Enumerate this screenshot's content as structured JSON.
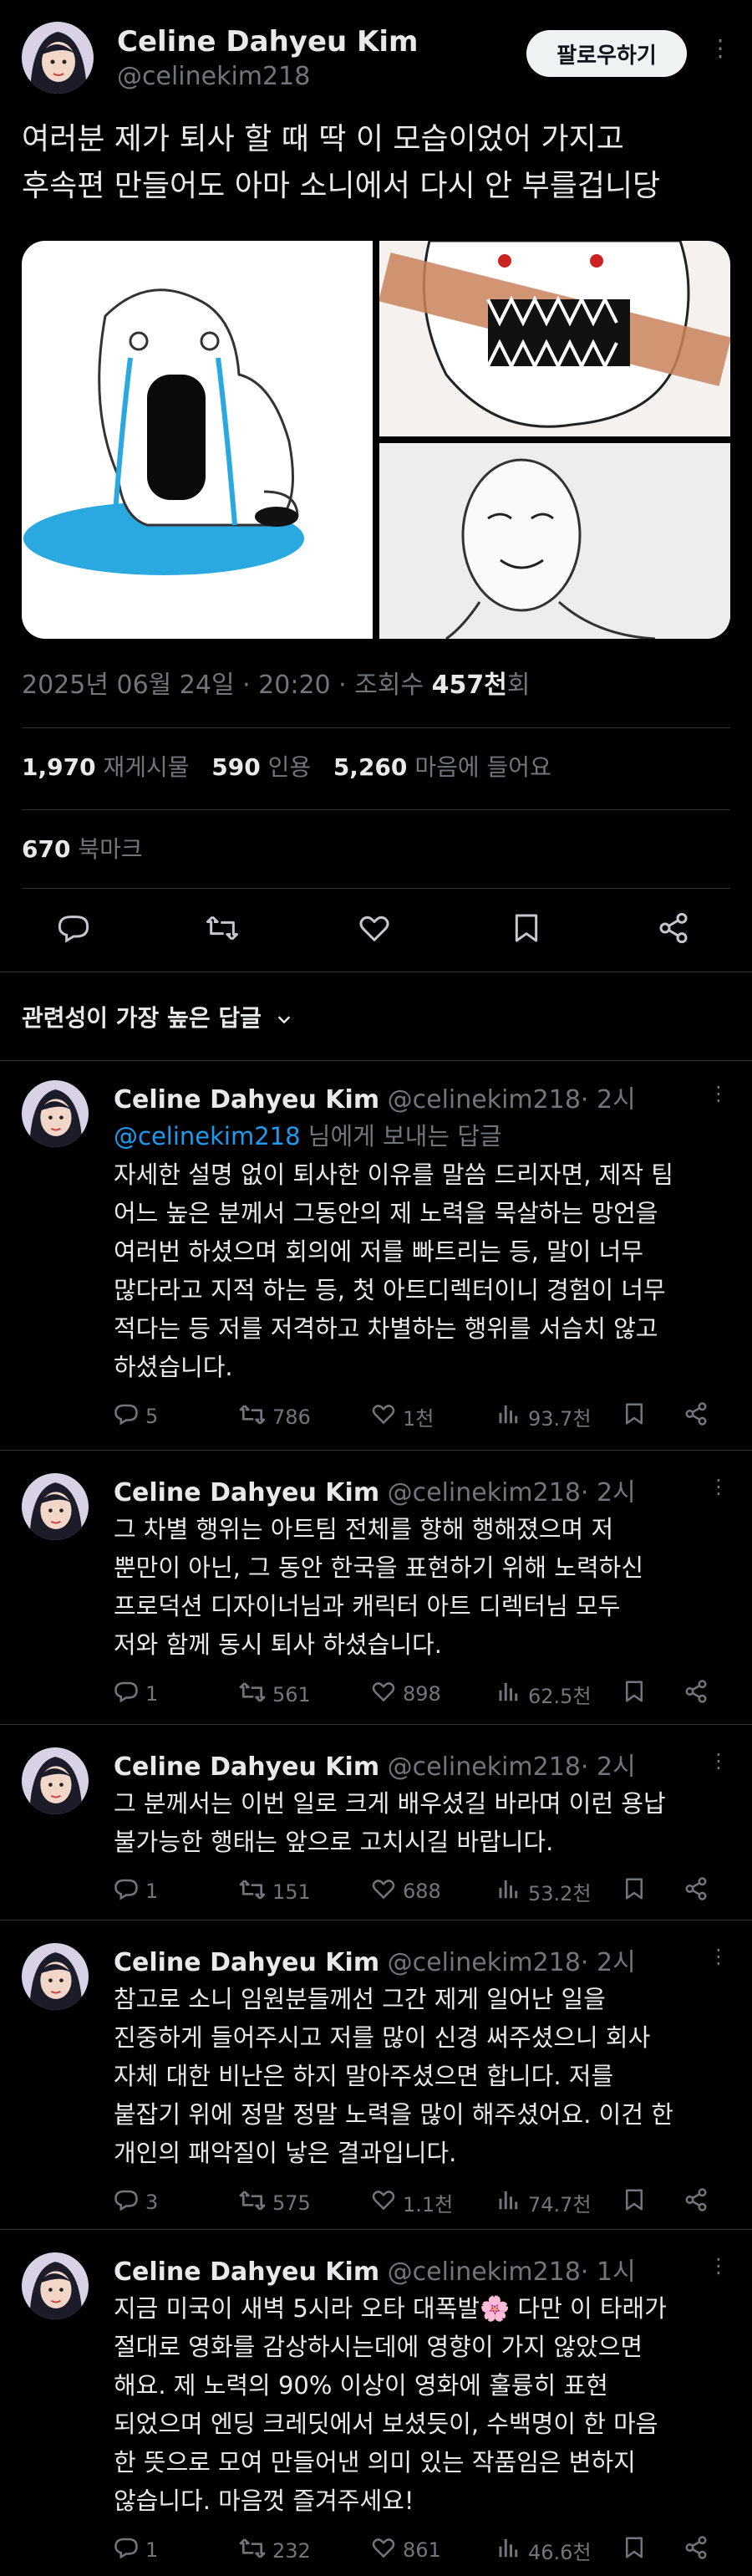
{
  "author": {
    "name": "Celine Dahyeu Kim",
    "handle": "@celinekim218",
    "follow_label": "팔로우하기"
  },
  "tweet": {
    "text_line1": "여러분 제가 퇴사 할 때 딱 이 모습이었어 가지고",
    "text_line2": "후속편 만들어도 아마 소니에서 다시 안 부를겁니당",
    "date": "2025년 06월 24일 · 20:20 · 조회수",
    "views": "457천",
    "views_suffix": "회"
  },
  "stats": {
    "retweets": "1,970",
    "retweets_label": "재게시물",
    "quotes": "590",
    "quotes_label": "인용",
    "likes": "5,260",
    "likes_label": "마음에 들어요",
    "bookmarks": "670",
    "bookmarks_label": "북마크"
  },
  "sort": {
    "label": "관련성이 가장 높은 답글"
  },
  "replies": [
    {
      "name": "Celine Dahyeu Kim",
      "handle": "@celinekim218",
      "time": "· 2시",
      "mention": "@celinekim218",
      "mention_suffix": " 님에게 보내는 답글",
      "lines": [
        "자세한 설명 없이 퇴사한 이유를 말씀 드리자면, 제작 팀",
        "어느 높은 분께서 그동안의 제 노력을 묵살하는 망언을",
        "여러번 하셨으며 회의에 저를 빠트리는 등, 말이 너무",
        "많다라고 지적 하는 등, 첫 아트디렉터이니 경험이 너무",
        "적다는 등 저를 저격하고 차별하는 행위를 서슴치 않고",
        "하셨습니다."
      ],
      "comments": "5",
      "retweets": "786",
      "likes": "1천",
      "views": "93.7천"
    },
    {
      "name": "Celine Dahyeu Kim",
      "handle": "@celinekim218",
      "time": "· 2시",
      "lines": [
        "그 차별 행위는 아트팀 전체를 향해 행해졌으며 저",
        "뿐만이 아닌, 그 동안 한국을 표현하기 위해 노력하신",
        "프로덕션 디자이너님과 캐릭터 아트 디렉터님 모두",
        "저와 함께 동시 퇴사 하셨습니다."
      ],
      "comments": "1",
      "retweets": "561",
      "likes": "898",
      "views": "62.5천"
    },
    {
      "name": "Celine Dahyeu Kim",
      "handle": "@celinekim218",
      "time": "· 2시",
      "lines": [
        "그 분께서는 이번 일로 크게 배우셨길 바라며 이런 용납",
        "불가능한 행태는 앞으로 고치시길 바랍니다."
      ],
      "comments": "1",
      "retweets": "151",
      "likes": "688",
      "views": "53.2천"
    },
    {
      "name": "Celine Dahyeu Kim",
      "handle": "@celinekim218",
      "time": "· 2시",
      "lines": [
        "참고로 소니 임원분들께선 그간 제게 일어난 일을",
        "진중하게 들어주시고 저를 많이 신경 써주셨으니 회사",
        "자체 대한 비난은 하지 말아주셨으면 합니다. 저를",
        "붙잡기 위에 정말 정말 노력을 많이 해주셨어요. 이건 한",
        "개인의 패악질이 낳은 결과입니다."
      ],
      "comments": "3",
      "retweets": "575",
      "likes": "1.1천",
      "views": "74.7천"
    },
    {
      "name": "Celine Dahyeu Kim",
      "handle": "@celinekim218",
      "time": "· 1시",
      "lines": [
        "지금 미국이 새벽 5시라 오타 대폭발🌸 다만 이 타래가",
        "절대로 영화를 감상하시는데에 영향이 가지 않았으면",
        "해요. 제 노력의 90% 이상이 영화에 훌륭히 표현",
        "되었으며 엔딩 크레딧에서 보셨듯이, 수백명이 한 마음",
        "한 뜻으로 모여 만들어낸 의미 있는 작품임은 변하지",
        "않습니다. 마음껏 즐겨주세요!"
      ],
      "comments": "1",
      "retweets": "232",
      "likes": "861",
      "views": "46.6천"
    }
  ]
}
